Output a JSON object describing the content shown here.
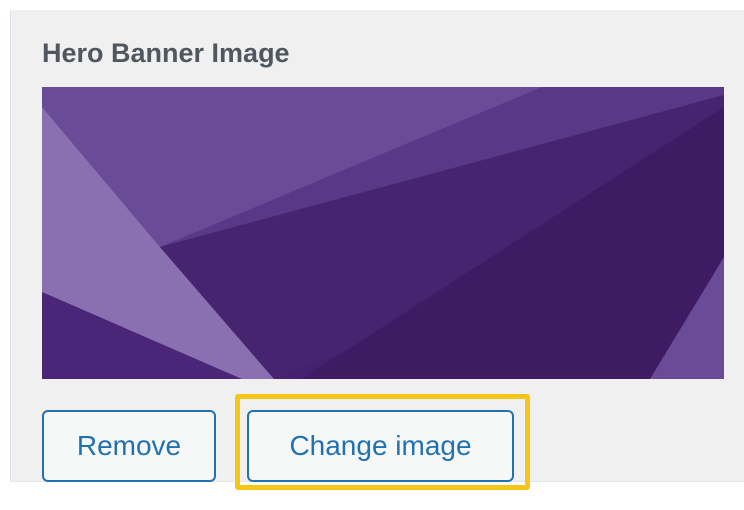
{
  "panel": {
    "title": "Hero Banner Image"
  },
  "banner_image": {
    "icon": "purple-geometric-banner",
    "colors": {
      "dark": "#3e1b62",
      "mid": "#482472",
      "light": "#6a4b97",
      "pale": "#8a70b0"
    }
  },
  "actions": {
    "remove_label": "Remove",
    "change_label": "Change image",
    "highlight_color": "#f5c518",
    "button_color": "#2271b1"
  }
}
